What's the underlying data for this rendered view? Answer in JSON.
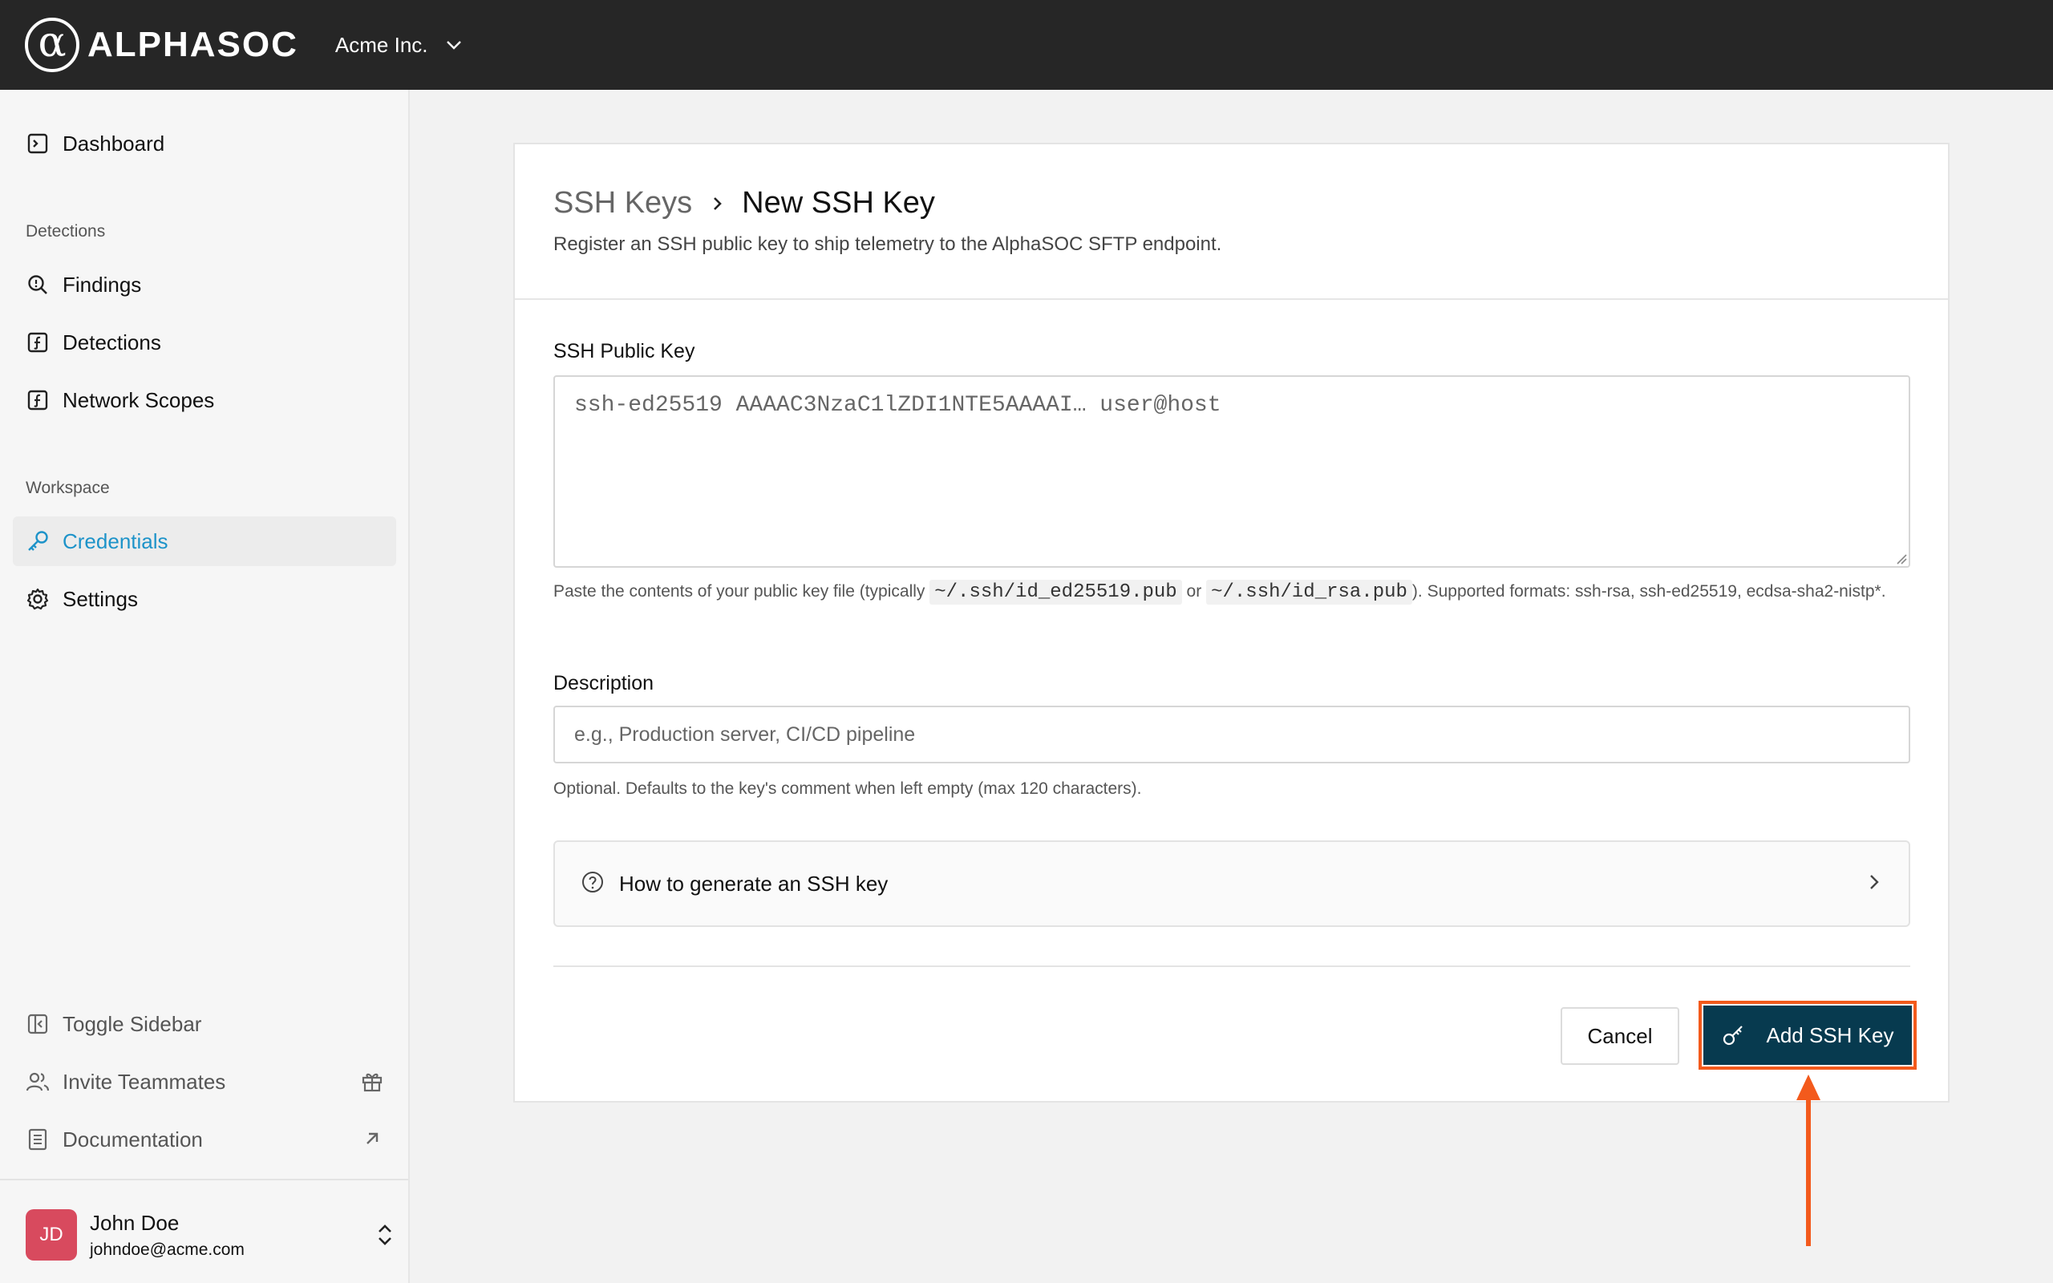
{
  "brand": {
    "name": "ALPHASOC",
    "mark": "α"
  },
  "org": {
    "name": "Acme Inc."
  },
  "sidebar": {
    "dashboard": "Dashboard",
    "sections": {
      "detections": "Detections",
      "workspace": "Workspace"
    },
    "items": {
      "findings": "Findings",
      "detections": "Detections",
      "network_scopes": "Network Scopes",
      "credentials": "Credentials",
      "settings": "Settings"
    },
    "active_item": "credentials",
    "bottom": {
      "toggle_sidebar": "Toggle Sidebar",
      "invite": "Invite Teammates",
      "docs": "Documentation"
    },
    "user": {
      "initials": "JD",
      "name": "John Doe",
      "email": "johndoe@acme.com"
    }
  },
  "page": {
    "breadcrumb_parent": "SSH Keys",
    "title": "New SSH Key",
    "subtitle": "Register an SSH public key to ship telemetry to the AlphaSOC SFTP endpoint."
  },
  "form": {
    "key": {
      "label": "SSH Public Key",
      "placeholder": "ssh-ed25519 AAAAC3NzaC1lZDI1NTE5AAAAI… user@host",
      "value": "",
      "help_prefix": "Paste the contents of your public key file (typically",
      "help_code1": "~/.ssh/id_ed25519.pub",
      "help_or": "or",
      "help_code2": "~/.ssh/id_rsa.pub",
      "help_suffix": "). Supported formats: ssh-rsa, ssh-ed25519, ecdsa-sha2-nistp*."
    },
    "description": {
      "label": "Description",
      "placeholder": "e.g., Production server, CI/CD pipeline",
      "value": "",
      "help": "Optional. Defaults to the key's comment when left empty (max 120 characters)."
    },
    "accordion": {
      "label": "How to generate an SSH key",
      "expanded": false
    },
    "actions": {
      "cancel": "Cancel",
      "submit": "Add SSH Key"
    }
  },
  "colors": {
    "topbar": "#262626",
    "accent": "#1d93c9",
    "primary_button": "#073a4f",
    "highlight": "#f35a1c",
    "avatar": "#d84a5e"
  },
  "icons": {
    "dashboard": "terminal-square-icon",
    "findings": "search-icon",
    "detections": "function-square-icon",
    "network_scopes": "function-square-icon",
    "credentials": "key-icon",
    "settings": "gear-icon",
    "toggle_sidebar": "panel-left-icon",
    "invite": "users-icon",
    "gift": "gift-icon",
    "docs": "document-icon",
    "external": "arrow-up-right-icon"
  }
}
